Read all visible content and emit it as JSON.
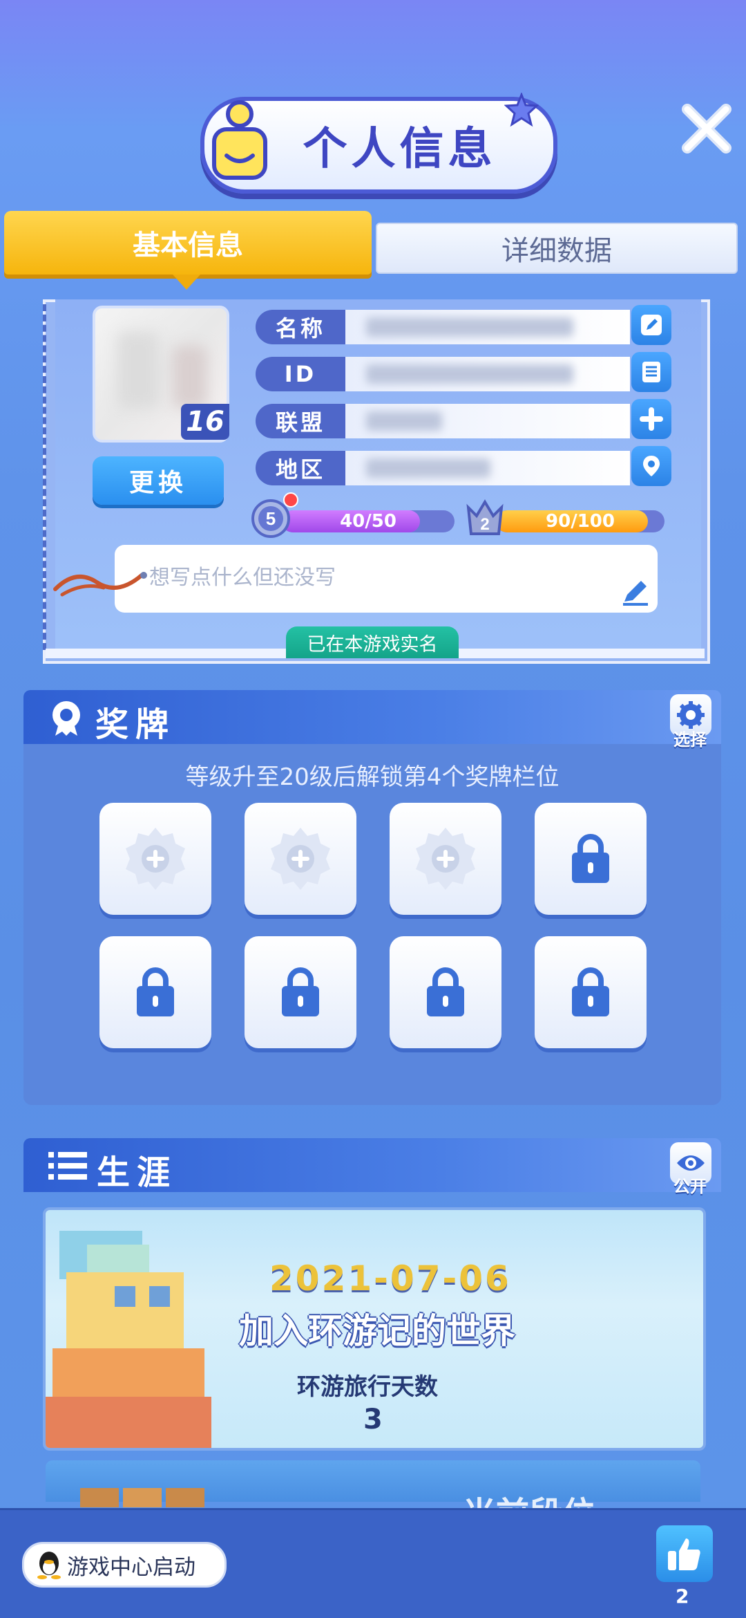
{
  "header": {
    "title": "个人信息"
  },
  "tabs": [
    {
      "label": "基本信息",
      "active": true
    },
    {
      "label": "详细数据",
      "active": false
    }
  ],
  "profile": {
    "avatar_level": "16",
    "change_button": "更换",
    "fields": [
      {
        "label": "名称",
        "icon": "pencil-icon"
      },
      {
        "label": "ID",
        "icon": "document-icon"
      },
      {
        "label": "联盟",
        "icon": "plus-icon"
      },
      {
        "label": "地区",
        "icon": "location-pin-icon"
      }
    ],
    "level": "5",
    "xp_text": "40/50",
    "xp_fraction": 0.8,
    "rank": "2",
    "rank_text": "90/100",
    "rank_fraction": 0.9,
    "signature_placeholder": "想写点什么但还没写",
    "realname_tag": "已在本游戏实名"
  },
  "medals": {
    "title": "奖牌",
    "action_label": "选择",
    "hint": "等级升至20级后解锁第4个奖牌栏位",
    "slots": [
      "add",
      "add",
      "add",
      "locked",
      "locked",
      "locked",
      "locked",
      "locked"
    ]
  },
  "career": {
    "title": "生涯",
    "action_label": "公开",
    "join_date": "2021-07-06",
    "join_text": "加入环游记的世界",
    "days_label": "环游旅行天数",
    "days_value": "3",
    "next_card_text": "当前段位"
  },
  "bottom": {
    "game_center_label": "游戏中心启动",
    "like_count": "2"
  },
  "colors": {
    "accent_yellow": "#f6b50d",
    "panel_blue": "#5a86dd",
    "header_blue": "#2f5fd2",
    "teal": "#14a489"
  }
}
